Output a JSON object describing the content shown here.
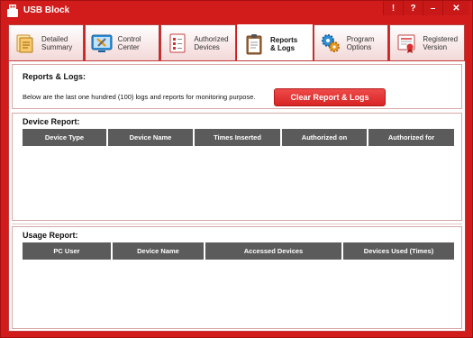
{
  "window": {
    "title": "USB Block",
    "buttons": {
      "pin": "!",
      "help": "?",
      "minimize": "–",
      "close": "✕"
    }
  },
  "tabs": [
    {
      "label": "Detailed\nSummary",
      "icon": "summary-icon"
    },
    {
      "label": "Control\nCenter",
      "icon": "tools-icon"
    },
    {
      "label": "Authorized\nDevices",
      "icon": "checklist-icon"
    },
    {
      "label": "Reports\n& Logs",
      "icon": "clipboard-icon",
      "active": true
    },
    {
      "label": "Program\nOptions",
      "icon": "gears-icon"
    },
    {
      "label": "Registered\nVersion",
      "icon": "certificate-icon"
    }
  ],
  "reports": {
    "title": "Reports & Logs:",
    "description": "Below are the last one hundred (100) logs and reports for monitoring purpose.",
    "clear_button": "Clear Report & Logs"
  },
  "device_report": {
    "title": "Device Report:",
    "columns": [
      "Device Type",
      "Device Name",
      "Times Inserted",
      "Authorized on",
      "Authorized for"
    ],
    "rows": []
  },
  "usage_report": {
    "title": "Usage Report:",
    "columns": [
      "PC User",
      "Device Name",
      "Accessed Devices",
      "Devices Used (Times)"
    ],
    "rows": []
  },
  "colors": {
    "accent": "#d21c1c",
    "header": "#5b5b5b",
    "button": "#e33a3a"
  }
}
